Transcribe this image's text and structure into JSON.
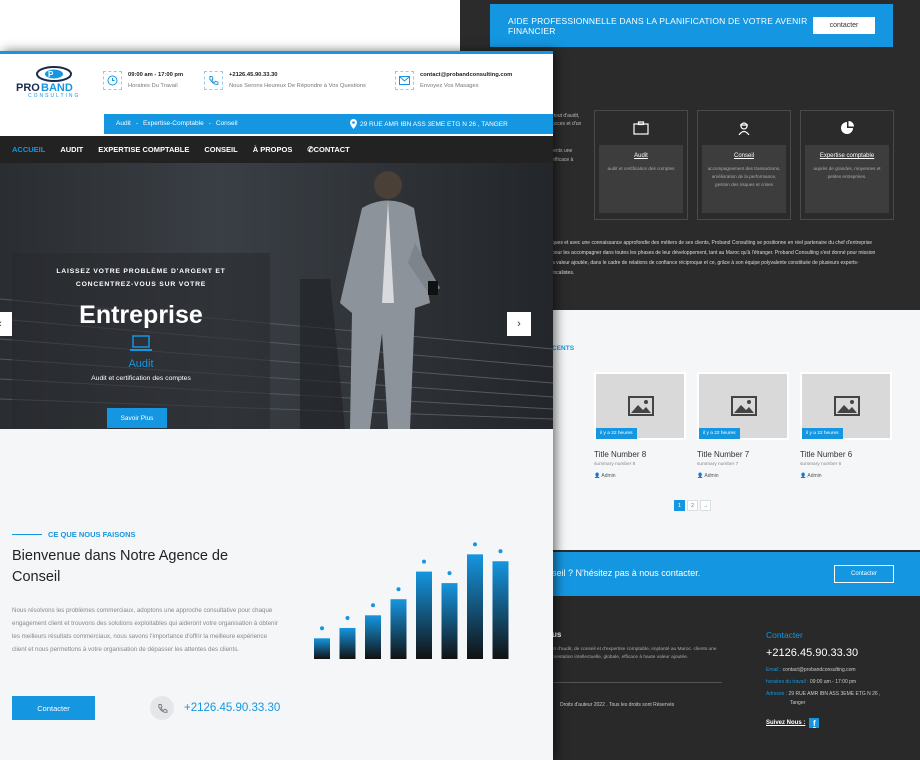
{
  "back": {
    "topbar": {
      "text": "AIDE PROFESSIONNELLE DANS LA PLANIFICATION DE VOTRE AVENIR FINANCIER",
      "button": "contacter"
    },
    "fragments": [
      "rtout d'audit,",
      "ucces et d'un",
      "ients une",
      "efficace à"
    ],
    "services": [
      {
        "icon": "briefcase-icon",
        "title": "Audit",
        "desc": "audit et certification des comptes"
      },
      {
        "icon": "worker-icon",
        "title": "Conseil",
        "desc": "accompagnement des transactions, amélioration de la performance, gestion des risques et crises"
      },
      {
        "icon": "pie-chart-icon",
        "title": "Expertise comptable",
        "desc": "auprès de grandes, moyennes et petites entreprises."
      }
    ],
    "paragraph": [
      "ques et avec une connaissance approfondie des métiers de ses clients, Proband Consulting se positionne en réel partenaire du chef d'entreprise",
      "pour les accompagner dans toutes les phases de leur développement, tant au Maroc qu'à l'étranger. Proband Consulting s'est donné pour mission",
      "a valeur ajoutée, dans le cadre de relations de confiance réciproque et ce, grâce à son équipe polyvalente constituée de plusieurs experts-",
      "focalistes."
    ],
    "recents_label": "CENTS",
    "posts": [
      {
        "badge": "il y a 22 heures",
        "title": "Title Number 8",
        "summary": "summary number 8",
        "author": "Admin"
      },
      {
        "badge": "il y a 22 heures",
        "title": "Title Number 7",
        "summary": "summary number 7",
        "author": "Admin"
      },
      {
        "badge": "il y a 22 heures",
        "title": "Title Number 6",
        "summary": "summary number 6",
        "author": "Admin"
      }
    ],
    "pager": [
      "1",
      "2",
      "→"
    ],
    "cta": {
      "text": "seil ? N'hésitez pas à nous contacter.",
      "button": "Contacter"
    },
    "footer": {
      "about_title": "us",
      "about_text": "et d'audit, de conseil et d'expertise comptable, implanté au Maroc. clients une prestation intellectuelle, globale, efficace à haute valeur ajoutée.",
      "copyright": "Droits d'auteur 2022 . Tous les droits sont Réservés",
      "contact_title": "Contacter",
      "phone": "+2126.45.90.33.30",
      "email_label": "Email :",
      "email": "contact@probandconsulting.com",
      "hours_label": "horaires du travail :",
      "hours": "09:00 am - 17:00 pm",
      "address_label": "Adresse :",
      "address": "29 RUE AMR IBN ASS 3EME ETG N 26 ,",
      "address2": "Tanger",
      "follow": "Suivez Nous :"
    }
  },
  "front": {
    "logo": {
      "name": "PROBAND",
      "sub": "CONSULTING",
      "colors": {
        "blue": "#1596e0",
        "dark": "#1a2a4a"
      }
    },
    "info": [
      {
        "icon": "clock-icon",
        "line1": "09:00 am - 17:00 pm",
        "line2": "Horaires Du Travail"
      },
      {
        "icon": "phone-icon",
        "line1": "+2126.45.90.33.30",
        "line2": "Nous Serons Heureux De Répondre à Vos Questions"
      },
      {
        "icon": "mail-icon",
        "line1": "contact@probandconsulting.com",
        "line2": "Envoyez Vos Masages"
      }
    ],
    "subnav": {
      "links": [
        "Audit",
        "-",
        "Expertise-Comptable",
        "-",
        "Conseil"
      ],
      "address": "29 RUE AMR IBN ASS 3EME ETG N 26 , TANGER"
    },
    "nav": [
      "ACCUEIL",
      "AUDIT",
      "EXPERTISE COMPTABLE",
      "CONSEIL",
      "À PROPOS",
      "CONTACT"
    ],
    "hero": {
      "tagline": "LAISSEZ VOTRE PROBLÈME D'ARGENT ET CONCENTREZ-VOUS SUR VOTRE",
      "title": "Entreprise",
      "service": "Audit",
      "service_desc": "Audit et certification des comptes",
      "button": "Savoir Plus",
      "prev": "‹",
      "next": "›"
    },
    "about": {
      "kicker": "CE QUE NOUS FAISONS",
      "heading": "Bienvenue dans Notre Agence de Conseil",
      "text": "Nous résolvons les problèmes commerciaux, adoptons une approche consultative pour chaque engagement client et trouvons des solutions exploitables qui aideront votre organisation à obtenir les meilleurs résultats commerciaux, nous savons l'importance d'offrir la meilleure expérience client et nous permettons à votre organisation de dépasser les attentes des clients.",
      "button": "Contacter",
      "phone": "+2126.45.90.33.30"
    },
    "bar_levels": [
      0.18,
      0.27,
      0.38,
      0.52,
      0.76,
      0.66,
      0.91,
      0.85
    ]
  },
  "colors": {
    "accent": "#1596e0",
    "dark": "#222222",
    "footer": "#2b2b2b"
  }
}
